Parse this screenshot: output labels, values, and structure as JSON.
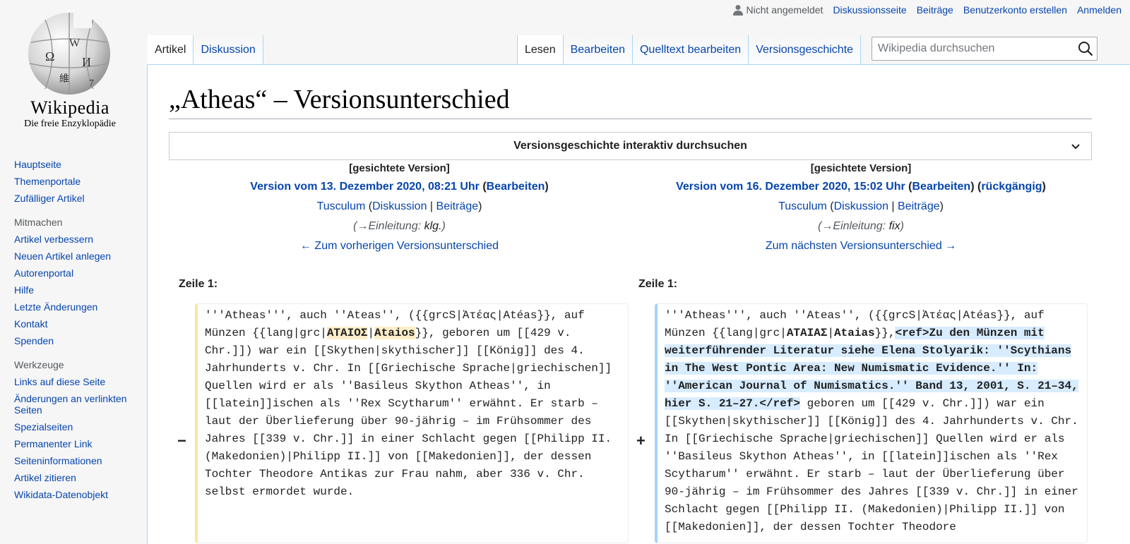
{
  "logo": {
    "wordmark": "Wikipedia",
    "tagline": "Die freie Enzyklopädie",
    "globe_glyphs": [
      "Ω",
      "W",
      "И",
      "維",
      "7"
    ]
  },
  "personal": {
    "user_status": "Nicht angemeldet",
    "links": [
      "Diskussionsseite",
      "Beiträge",
      "Benutzerkonto erstellen",
      "Anmelden"
    ]
  },
  "tabs": {
    "left": [
      {
        "label": "Artikel",
        "selected": true
      },
      {
        "label": "Diskussion",
        "selected": false
      }
    ],
    "right": [
      {
        "label": "Lesen",
        "selected": true
      },
      {
        "label": "Bearbeiten",
        "selected": false
      },
      {
        "label": "Quelltext bearbeiten",
        "selected": false
      },
      {
        "label": "Versionsgeschichte",
        "selected": false
      }
    ]
  },
  "search": {
    "placeholder": "Wikipedia durchsuchen"
  },
  "sidebar": {
    "navigation": [
      "Hauptseite",
      "Themenportale",
      "Zufälliger Artikel"
    ],
    "mitmachen": {
      "heading": "Mitmachen",
      "items": [
        "Artikel verbessern",
        "Neuen Artikel anlegen",
        "Autorenportal",
        "Hilfe",
        "Letzte Änderungen",
        "Kontakt",
        "Spenden"
      ]
    },
    "werkzeuge": {
      "heading": "Werkzeuge",
      "items": [
        "Links auf diese Seite",
        "Änderungen an verlinkten Seiten",
        "Spezialseiten",
        "Permanenter Link",
        "Seiteninformationen",
        "Artikel zitieren",
        "Wikidata-Datenobjekt"
      ]
    }
  },
  "page": {
    "title": "„Atheas“ – Versionsunterschied",
    "history_bar": "Versionsgeschichte interaktiv durchsuchen"
  },
  "diff": {
    "left": {
      "flag": "[gesichtete Version]",
      "version": "Version vom 13. Dezember 2020, 08:21 Uhr",
      "edit": "Bearbeiten",
      "user": "Tusculum",
      "talk": "Diskussion",
      "contribs": "Beiträge",
      "summary_section": "→Einleitung:",
      "summary_text": "klg.",
      "nav": "← Zum vorherigen Versionsunterschied",
      "line": "Zeile 1:",
      "marker": "−",
      "segments": [
        {
          "t": "'''Atheas''', auch ''Ateas'', ({{grcS|Ἀτέας|Atéas}}, auf Münzen {{lang|grc|",
          "h": false
        },
        {
          "t": "ΑΤΑΙΟΣ",
          "h": true
        },
        {
          "t": "|",
          "h": false
        },
        {
          "t": "Ataios",
          "h": true
        },
        {
          "t": "}}, geboren um [[429 v. Chr.]]) war ein [[Skythen|skythischer]] [[König]] des 4. Jahrhunderts v. Chr. In [[Griechische Sprache|griechischen]] Quellen wird er als ''Basileus Skython Atheas'', in [[latein]]ischen als ''Rex Scytharum'' erwähnt. Er starb – laut der Überlieferung über 90-jährig – im Frühsommer des Jahres [[339 v. Chr.]] in einer Schlacht gegen [[Philipp II. (Makedonien)|Philipp II.]] von [[Makedonien]], der dessen Tochter Theodore Antikas zur Frau nahm, aber 336 v. Chr. selbst ermordet wurde.",
          "h": false
        }
      ]
    },
    "right": {
      "flag": "[gesichtete Version]",
      "version": "Version vom 16. Dezember 2020, 15:02 Uhr",
      "edit": "Bearbeiten",
      "undo": "rückgängig",
      "user": "Tusculum",
      "talk": "Diskussion",
      "contribs": "Beiträge",
      "summary_section": "→Einleitung:",
      "summary_text": "fix",
      "nav": "Zum nächsten Versionsunterschied →",
      "line": "Zeile 1:",
      "marker": "+",
      "segments": [
        {
          "t": "'''Atheas''', auch ''Ateas'', ({{grcS|Ἀτέας|Atéas}}, auf Münzen {{lang|grc|",
          "h": false
        },
        {
          "t": "ΑΤΑΙΑΣ",
          "h": "plain"
        },
        {
          "t": "|",
          "h": false
        },
        {
          "t": "Ataias",
          "h": "plain"
        },
        {
          "t": "}},",
          "h": false
        },
        {
          "t": "<ref>Zu den Münzen mit weiterführender Literatur siehe Elena Stolyarik: ''Scythians in The West Pontic Area: New Numismatic Evidence.'' In: ''American Journal of Numismatics.'' Band 13, 2001, S. 21–34, hier S. 21–27.</ref>",
          "h": true
        },
        {
          "t": " geboren um [[429 v. Chr.]]) war ein [[Skythen|skythischer]] [[König]] des 4. Jahrhunderts v. Chr. In [[Griechische Sprache|griechischen]] Quellen wird er als ''Basileus Skython Atheas'', in [[latein]]ischen als ''Rex Scytharum'' erwähnt. Er starb – laut der Überlieferung über 90-jährig – im Frühsommer des Jahres [[339 v. Chr.]] in einer Schlacht gegen [[Philipp II. (Makedonien)|Philipp II.]] von [[Makedonien]], der dessen Tochter Theodore",
          "h": false
        }
      ]
    }
  }
}
